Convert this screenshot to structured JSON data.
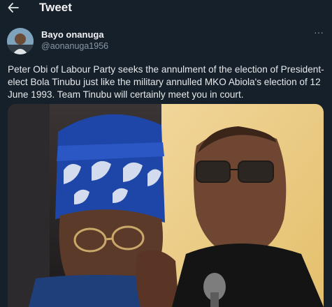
{
  "header": {
    "title": "Tweet",
    "back_icon": "arrow-left-icon"
  },
  "tweet": {
    "author_name": "Bayo onanuga",
    "author_handle": "@aonanuga1956",
    "more_icon": "more-horizontal-icon",
    "text": "Peter Obi of Labour Party seeks the annulment of the election of President-elect Bola Tinubu just like the military annulled MKO Abiola's election of 12 June 1993. Team Tinubu will certainly meet you in court."
  },
  "colors": {
    "background": "#15202b",
    "text": "#e7e9ea",
    "secondary": "#8b98a5"
  }
}
